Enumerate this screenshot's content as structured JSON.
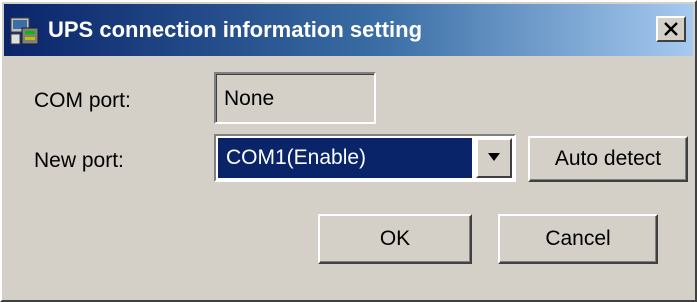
{
  "window": {
    "title": "UPS connection information setting",
    "close_label": "X"
  },
  "form": {
    "com_port": {
      "label": "COM port:",
      "value": "None"
    },
    "new_port": {
      "label": "New port:",
      "selected": "COM1(Enable)"
    },
    "auto_detect_label": "Auto detect"
  },
  "actions": {
    "ok_label": "OK",
    "cancel_label": "Cancel"
  },
  "icons": {
    "title": "ups-app-icon",
    "close": "close-icon",
    "dropdown": "chevron-down-icon"
  },
  "colors": {
    "titlebar_start": "#0a246a",
    "titlebar_end": "#a6caf0",
    "dialog_face": "#d4d0c8",
    "selection": "#0a246a"
  }
}
